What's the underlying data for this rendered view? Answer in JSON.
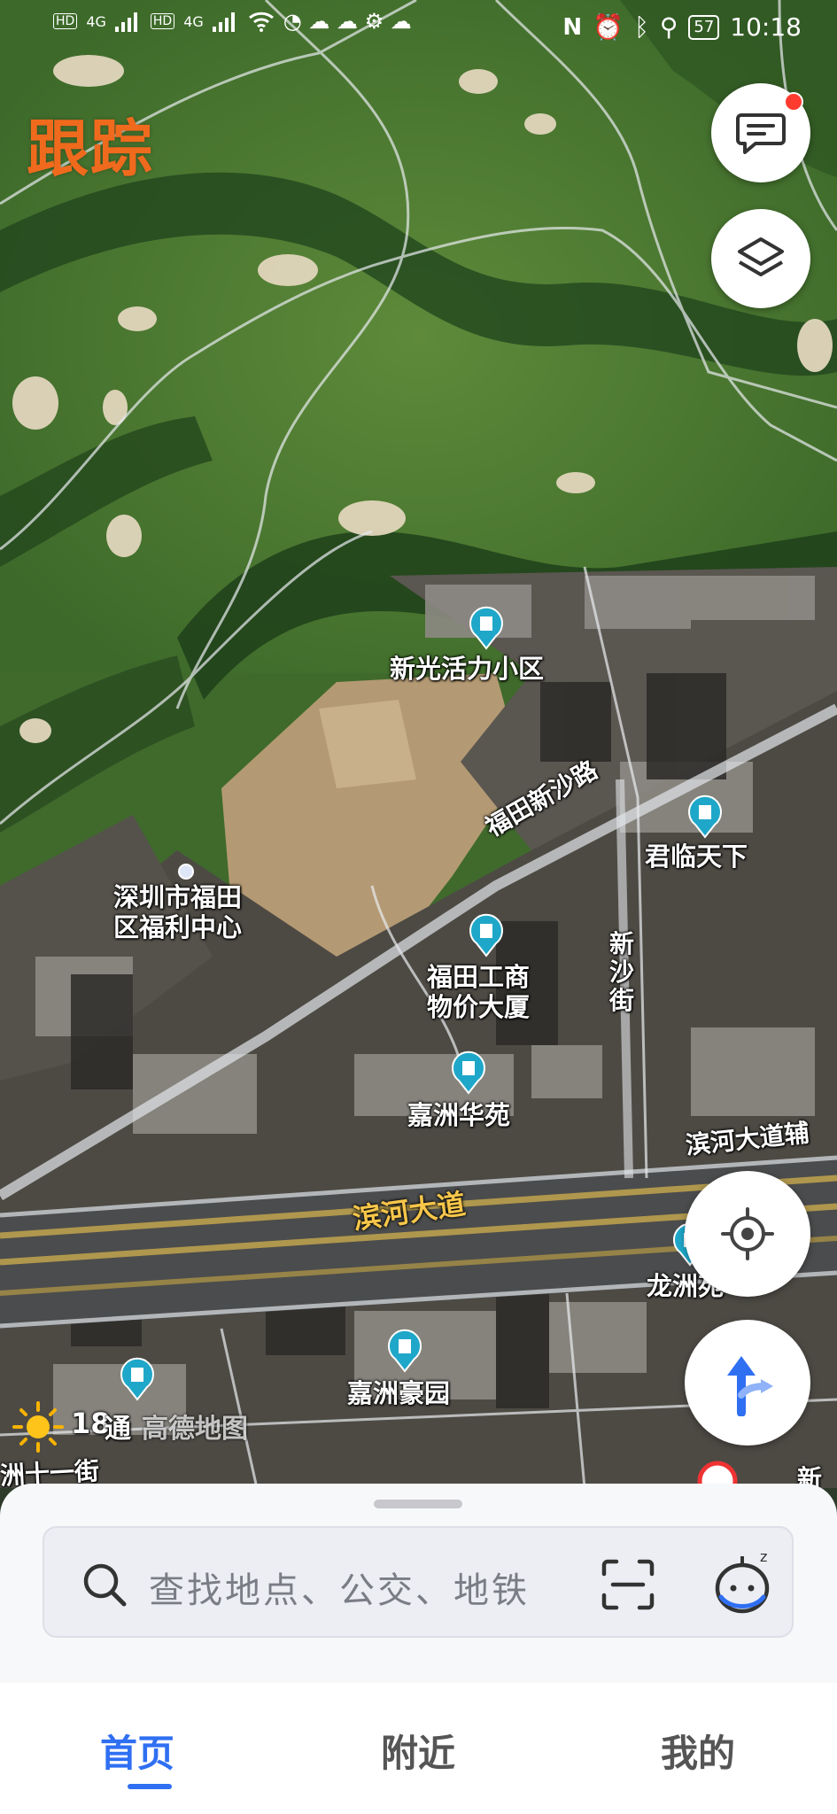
{
  "status_bar": {
    "left_indicators": [
      "HD",
      "4G",
      "HD",
      "4G"
    ],
    "battery": "57",
    "time": "10:18",
    "icons": [
      "nfc-icon",
      "alarm-icon",
      "bluetooth-icon",
      "location-icon",
      "battery-icon"
    ]
  },
  "overlay": {
    "brand_text": "跟踪"
  },
  "map": {
    "pois": [
      {
        "name": "新光活力小区"
      },
      {
        "name": "君临天下"
      },
      {
        "name": "深圳市福田\n区福利中心"
      },
      {
        "name": "福田工商\n物价大厦"
      },
      {
        "name": "嘉洲华苑"
      },
      {
        "name": "龙洲苑"
      },
      {
        "name": "嘉洲豪园"
      }
    ],
    "roads": [
      {
        "name": "福田新沙路"
      },
      {
        "name": "新\n沙\n街"
      },
      {
        "name": "滨河大道"
      },
      {
        "name": "滨河大道辅"
      },
      {
        "name": "洲十一街"
      },
      {
        "name": "新"
      }
    ],
    "weather": {
      "temp": "18",
      "icon": "sun-icon"
    },
    "watermark": "高德地图",
    "partial_label": "通"
  },
  "search": {
    "placeholder": "查找地点、公交、地铁",
    "icons": [
      "search-icon",
      "scan-icon",
      "assistant-icon"
    ]
  },
  "tabs": [
    {
      "label": "首页",
      "active": true
    },
    {
      "label": "附近",
      "active": false
    },
    {
      "label": "我的",
      "active": false
    }
  ],
  "colors": {
    "accent": "#2f6ff2",
    "notification": "#ff3b30",
    "road_label": "#f7c64a",
    "poi_pin": "#1fa7c9"
  }
}
